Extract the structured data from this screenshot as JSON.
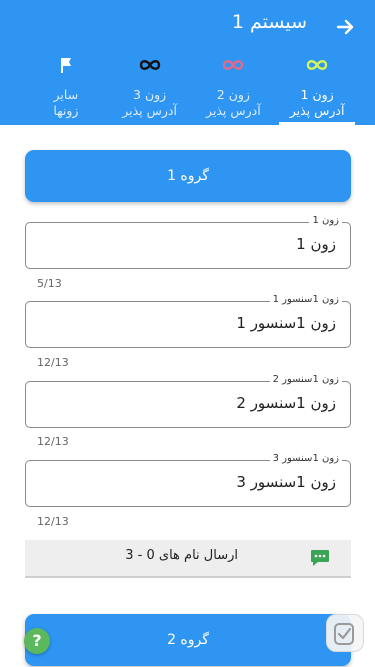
{
  "appbar": {
    "title": "سیستم 1",
    "back_icon": "arrow-right-icon"
  },
  "tabs": [
    {
      "label": "زون 1\nآدرس پذیر",
      "icon": "infinity-icon",
      "icon_color": "#d7f55a",
      "active": true
    },
    {
      "label": "زون 2\nآدرس پذیر",
      "icon": "infinity-icon",
      "icon_color": "#e06a8c",
      "active": false
    },
    {
      "label": "زون 3\nآدرس پذیر",
      "icon": "infinity-icon",
      "icon_color": "#111111",
      "active": false
    },
    {
      "label": "سایر\nزونها",
      "icon": "flag-icon",
      "icon_color": "#ffffff",
      "active": false
    }
  ],
  "groups": {
    "group1_label": "گروه 1",
    "group2_label": "گروه 2"
  },
  "fields": [
    {
      "label": "زون 1",
      "value": "زون 1",
      "counter": "5/13"
    },
    {
      "label": "زون 1سنسور 1",
      "value": "زون 1سنسور 1",
      "counter": "12/13"
    },
    {
      "label": "زون 1سنسور 2",
      "value": "زون 1سنسور 2",
      "counter": "12/13"
    },
    {
      "label": "زون 1سنسور 3",
      "value": "زون 1سنسور 3",
      "counter": "12/13"
    }
  ],
  "send": {
    "label": "ارسال نام های 0 - 3",
    "icon": "message-icon"
  },
  "help": {
    "label": "?"
  },
  "colors": {
    "primary": "#2e95f2",
    "help_green": "#5cb85c",
    "send_icon": "#3aa655"
  }
}
